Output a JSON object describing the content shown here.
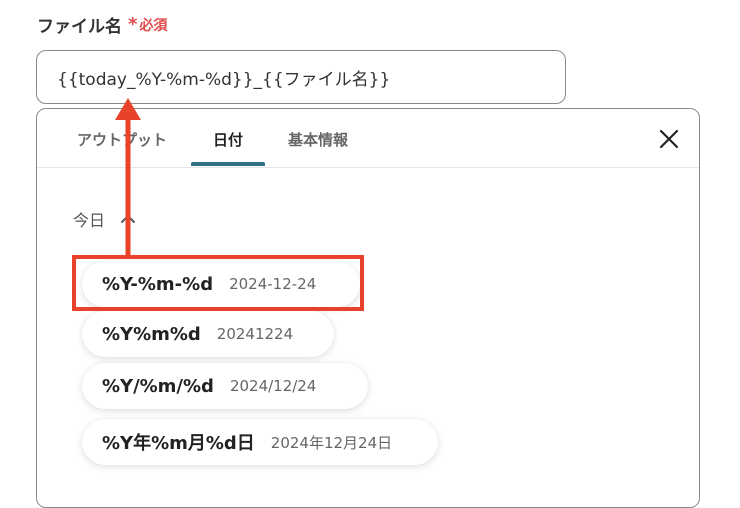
{
  "field": {
    "label": "ファイル名",
    "required_mark": "*",
    "required_text": "必須",
    "value": "{{today_%Y-%m-%d}}_{{ファイル名}}"
  },
  "tabs": [
    {
      "label": "アウトプット"
    },
    {
      "label": "日付",
      "active": true
    },
    {
      "label": "基本情報"
    }
  ],
  "section": {
    "title": "今日"
  },
  "formats": [
    {
      "format": "%Y-%m-%d",
      "example": "2024-12-24"
    },
    {
      "format": "%Y%m%d",
      "example": "20241224"
    },
    {
      "format": "%Y/%m/%d",
      "example": "2024/12/24"
    },
    {
      "format": "%Y年%m月%d日",
      "example": "2024年12月24日"
    }
  ],
  "icons": {
    "close": "close-icon",
    "chevron": "chevron-up-icon",
    "arrow": "arrow-up-icon"
  },
  "colors": {
    "required": "#e04b4b",
    "annotation": "#e8432a",
    "tab_active": "#2e6f86"
  }
}
